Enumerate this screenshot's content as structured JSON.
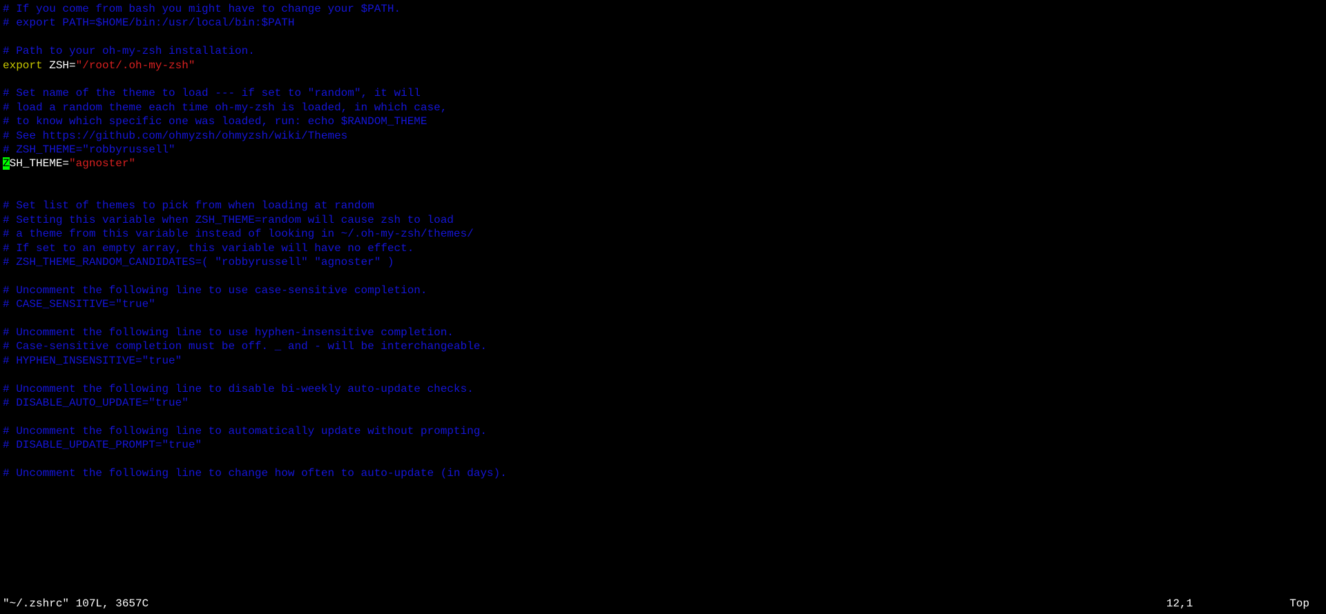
{
  "lines": [
    {
      "type": "comment",
      "text": "# If you come from bash you might have to change your $PATH."
    },
    {
      "type": "comment",
      "text": "# export PATH=$HOME/bin:/usr/local/bin:$PATH"
    },
    {
      "type": "blank",
      "text": ""
    },
    {
      "type": "comment",
      "text": "# Path to your oh-my-zsh installation."
    },
    {
      "type": "export1",
      "keyword": "export",
      "var": " ZSH=",
      "string": "\"/root/.oh-my-zsh\""
    },
    {
      "type": "blank",
      "text": ""
    },
    {
      "type": "comment",
      "text": "# Set name of the theme to load --- if set to \"random\", it will"
    },
    {
      "type": "comment",
      "text": "# load a random theme each time oh-my-zsh is loaded, in which case,"
    },
    {
      "type": "comment",
      "text": "# to know which specific one was loaded, run: echo $RANDOM_THEME"
    },
    {
      "type": "comment",
      "text": "# See https://github.com/ohmyzsh/ohmyzsh/wiki/Themes"
    },
    {
      "type": "comment",
      "text": "# ZSH_THEME=\"robbyrussell\""
    },
    {
      "type": "assign",
      "cursor_char": "Z",
      "var": "SH_THEME=",
      "string": "\"agnoster\""
    },
    {
      "type": "blank",
      "text": ""
    },
    {
      "type": "blank",
      "text": ""
    },
    {
      "type": "comment",
      "text": "# Set list of themes to pick from when loading at random"
    },
    {
      "type": "comment",
      "text": "# Setting this variable when ZSH_THEME=random will cause zsh to load"
    },
    {
      "type": "comment",
      "text": "# a theme from this variable instead of looking in ~/.oh-my-zsh/themes/"
    },
    {
      "type": "comment",
      "text": "# If set to an empty array, this variable will have no effect."
    },
    {
      "type": "comment",
      "text": "# ZSH_THEME_RANDOM_CANDIDATES=( \"robbyrussell\" \"agnoster\" )"
    },
    {
      "type": "blank",
      "text": ""
    },
    {
      "type": "comment",
      "text": "# Uncomment the following line to use case-sensitive completion."
    },
    {
      "type": "comment",
      "text": "# CASE_SENSITIVE=\"true\""
    },
    {
      "type": "blank",
      "text": ""
    },
    {
      "type": "comment",
      "text": "# Uncomment the following line to use hyphen-insensitive completion."
    },
    {
      "type": "comment",
      "text": "# Case-sensitive completion must be off. _ and - will be interchangeable."
    },
    {
      "type": "comment",
      "text": "# HYPHEN_INSENSITIVE=\"true\""
    },
    {
      "type": "blank",
      "text": ""
    },
    {
      "type": "comment",
      "text": "# Uncomment the following line to disable bi-weekly auto-update checks."
    },
    {
      "type": "comment",
      "text": "# DISABLE_AUTO_UPDATE=\"true\""
    },
    {
      "type": "blank",
      "text": ""
    },
    {
      "type": "comment",
      "text": "# Uncomment the following line to automatically update without prompting."
    },
    {
      "type": "comment",
      "text": "# DISABLE_UPDATE_PROMPT=\"true\""
    },
    {
      "type": "blank",
      "text": ""
    },
    {
      "type": "comment",
      "text": "# Uncomment the following line to change how often to auto-update (in days)."
    }
  ],
  "status": {
    "filename": "\"~/.zshrc\" 107L, 3657C",
    "position": "12,1",
    "scroll": "Top"
  }
}
